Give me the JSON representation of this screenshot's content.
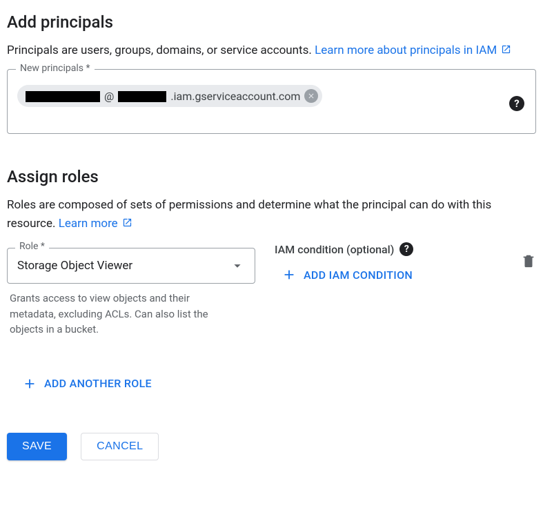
{
  "section_principals": {
    "heading": "Add principals",
    "desc_prefix": "Principals are users, groups, domains, or service accounts. ",
    "learn_link": "Learn more about principals in IAM",
    "field_label": "New principals *",
    "chip": {
      "middle": "@",
      "suffix": ".iam.gserviceaccount.com"
    }
  },
  "section_roles": {
    "heading": "Assign roles",
    "desc_prefix": "Roles are composed of sets of permissions and determine what the principal can do with this resource. ",
    "learn_link": "Learn more",
    "role_label": "Role *",
    "role_value": "Storage Object Viewer",
    "role_helper": "Grants access to view objects and their metadata, excluding ACLs. Can also list the objects in a bucket.",
    "condition_label": "IAM condition (optional)",
    "add_condition": "Add IAM condition",
    "add_role": "Add another role"
  },
  "footer": {
    "save": "Save",
    "cancel": "Cancel"
  }
}
